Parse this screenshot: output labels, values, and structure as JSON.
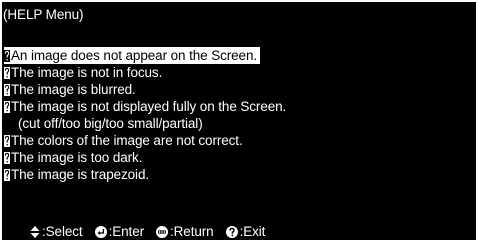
{
  "menu": {
    "title": "(HELP Menu)",
    "items": [
      {
        "label": "An image does not appear on the Screen."
      },
      {
        "label": "The image is not in focus."
      },
      {
        "label": "The image is blurred."
      },
      {
        "label": "The image is not displayed fully on the Screen."
      },
      {
        "label": "The colors of the image are not correct."
      },
      {
        "label": "The image is too dark."
      },
      {
        "label": "The image is trapezoid."
      }
    ],
    "item4_sub": "(cut off/too big/too small/partial)",
    "selected_index": 0
  },
  "footer": {
    "select_label": ":Select",
    "enter_label": ":Enter",
    "return_label": ":Return",
    "exit_label": ":Exit",
    "select_icon": "up-down-arrows-icon",
    "enter_icon": "enter-icon",
    "return_icon": "esc-icon",
    "exit_icon": "help-icon"
  },
  "colors": {
    "background": "#000000",
    "text": "#ffffff",
    "highlight_bg": "#ffffff",
    "highlight_text": "#000000"
  }
}
